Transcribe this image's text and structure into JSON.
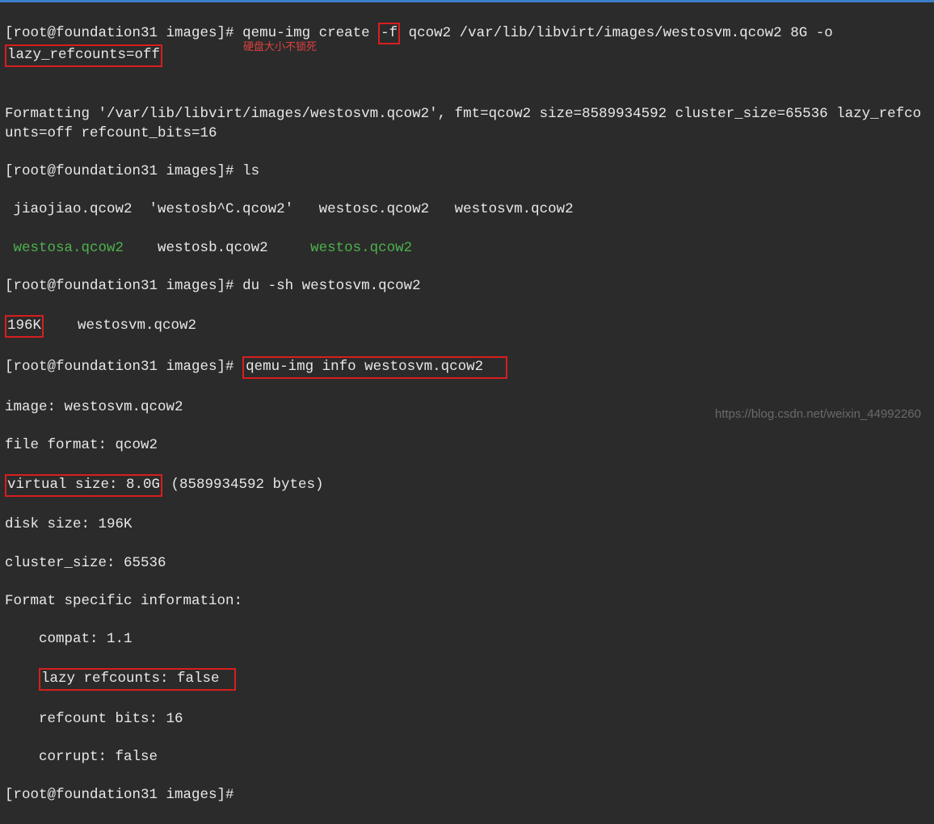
{
  "prompt": {
    "user": "root",
    "host": "foundation31",
    "dir": "images",
    "prefix": "[root@foundation31 images]#"
  },
  "cmd1": {
    "part1": "qemu-img create ",
    "flag_f": "-f",
    "part2": " qcow2 /var/lib/libvirt/images/westosvm.qcow2 8G -o ",
    "lazy_opt": "lazy_refcounts=off"
  },
  "annotation1": "硬盘大小不锁死",
  "format_output": "Formatting '/var/lib/libvirt/images/westosvm.qcow2', fmt=qcow2 size=8589934592 cluster_size=65536 lazy_refcounts=off refcount_bits=16",
  "cmd2": "ls",
  "ls_output": {
    "row1": {
      "col1": " jiaojiao.qcow2  'westosb^C.qcow2'   westosc.qcow2   westosvm.qcow2",
      "col1_plain": " jiaojiao.qcow2  'westosb^C.qcow2'   westosc.qcow2   westosvm.qcow2"
    },
    "row2": {
      "green1": " westosa.qcow2",
      "plain1": "    westosb.qcow2     ",
      "green2": "westos.qcow2"
    }
  },
  "cmd3": "du -sh westosvm.qcow2",
  "du_output": {
    "size": "196K",
    "rest": "    westosvm.qcow2"
  },
  "cmd4": "qemu-img info westosvm.qcow2",
  "info_output": {
    "image": "image: westosvm.qcow2",
    "file_format": "file format: qcow2",
    "virtual_size_boxed": "virtual size: 8.0G",
    "virtual_size_rest": " (8589934592 bytes)",
    "disk_size": "disk size: 196K",
    "cluster_size": "cluster_size: 65536",
    "format_specific": "Format specific information:",
    "compat": "    compat: 1.1",
    "lazy_refcounts": "lazy refcounts: false",
    "lazy_indent": "    ",
    "refcount_bits": "    refcount bits: 16",
    "corrupt": "    corrupt: false"
  },
  "watermark": "https://blog.csdn.net/weixin_44992260"
}
